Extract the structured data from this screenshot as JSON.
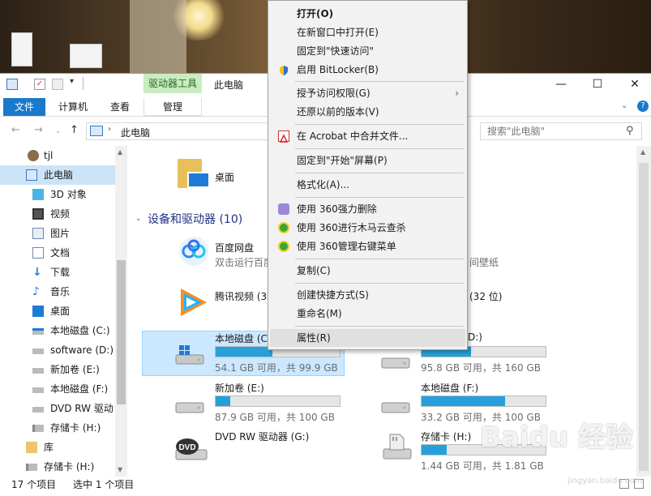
{
  "window": {
    "title": "此电脑",
    "context_tab": "驱动器工具"
  },
  "ribbon": {
    "tabs": [
      "文件",
      "计算机",
      "查看"
    ],
    "manage": "管理"
  },
  "address": {
    "path": "此电脑",
    "search_placeholder": "搜索\"此电脑\""
  },
  "nav": [
    {
      "label": "tjl",
      "icon": "user-icon"
    },
    {
      "label": "此电脑",
      "icon": "computer-icon",
      "selected": true
    },
    {
      "label": "3D 对象",
      "icon": "cube-icon"
    },
    {
      "label": "视频",
      "icon": "video-icon"
    },
    {
      "label": "图片",
      "icon": "picture-icon"
    },
    {
      "label": "文档",
      "icon": "document-icon"
    },
    {
      "label": "下载",
      "icon": "download-icon"
    },
    {
      "label": "音乐",
      "icon": "music-icon"
    },
    {
      "label": "桌面",
      "icon": "desktop-icon"
    },
    {
      "label": "本地磁盘 (C:)",
      "icon": "system-drive-icon"
    },
    {
      "label": "software (D:)",
      "icon": "drive-icon"
    },
    {
      "label": "新加卷 (E:)",
      "icon": "drive-icon"
    },
    {
      "label": "本地磁盘 (F:)",
      "icon": "drive-icon"
    },
    {
      "label": "DVD RW 驱动",
      "icon": "dvd-icon"
    },
    {
      "label": "存储卡 (H:)",
      "icon": "sdcard-icon"
    },
    {
      "label": "库",
      "icon": "library-icon"
    },
    {
      "label": "存储卡 (H:)",
      "icon": "sdcard-icon"
    }
  ],
  "content": {
    "desktop_folder": "桌面",
    "group_header": "设备和驱动器 (10)",
    "apps": [
      {
        "name": "百度网盘",
        "sub": "双击运行百度"
      },
      {
        "name": "腾讯视频 (3",
        "sub": ""
      }
    ],
    "right_fragments": {
      "wallpaper": "间壁纸",
      "bit32": "(32 位)",
      "d_label": "D:)"
    },
    "drives": [
      {
        "name": "本地磁盘 (C",
        "sub": "54.1 GB 可用，共 99.9 GB",
        "fill": 0.46
      },
      {
        "name": "",
        "sub": "95.8 GB 可用，共 160 GB",
        "fill": 0.4
      },
      {
        "name": "新加卷 (E:)",
        "sub": "87.9 GB 可用，共 100 GB",
        "fill": 0.12
      },
      {
        "name": "本地磁盘 (F:)",
        "sub": "33.2 GB 可用，共 100 GB",
        "fill": 0.67
      },
      {
        "name": "DVD RW 驱动器 (G:)",
        "sub": ""
      },
      {
        "name": "存储卡 (H:)",
        "sub": "1.44 GB 可用，共 1.81 GB",
        "fill": 0.2
      }
    ]
  },
  "status": {
    "count": "17 个项目",
    "selected": "选中 1 个项目"
  },
  "menu": [
    {
      "label": "打开(O)",
      "bold": true
    },
    {
      "label": "在新窗口中打开(E)"
    },
    {
      "label": "固定到\"快速访问\""
    },
    {
      "label": "启用 BitLocker(B)",
      "icon": "shield-icon"
    },
    {
      "label": "授予访问权限(G)",
      "submenu": true
    },
    {
      "label": "还原以前的版本(V)"
    },
    {
      "label": "在 Acrobat 中合并文件...",
      "icon": "acrobat-icon"
    },
    {
      "label": "固定到\"开始\"屏幕(P)"
    },
    {
      "label": "格式化(A)..."
    },
    {
      "label": "使用 360强力删除",
      "icon": "360-delete-icon"
    },
    {
      "label": "使用 360进行木马云查杀",
      "icon": "360-scan-icon"
    },
    {
      "label": "使用 360管理右键菜单",
      "icon": "360-menu-icon"
    },
    {
      "label": "复制(C)"
    },
    {
      "label": "创建快捷方式(S)"
    },
    {
      "label": "重命名(M)"
    },
    {
      "label": "属性(R)",
      "highlighted": true
    }
  ],
  "watermark": {
    "text": "Baidu 经验",
    "sub": "jingyan.baidu.com"
  },
  "colors": {
    "accent": "#1979ca",
    "context_tab": "#c9ecc0",
    "bar_fill": "#26a0da",
    "selection": "#cce4f7"
  }
}
